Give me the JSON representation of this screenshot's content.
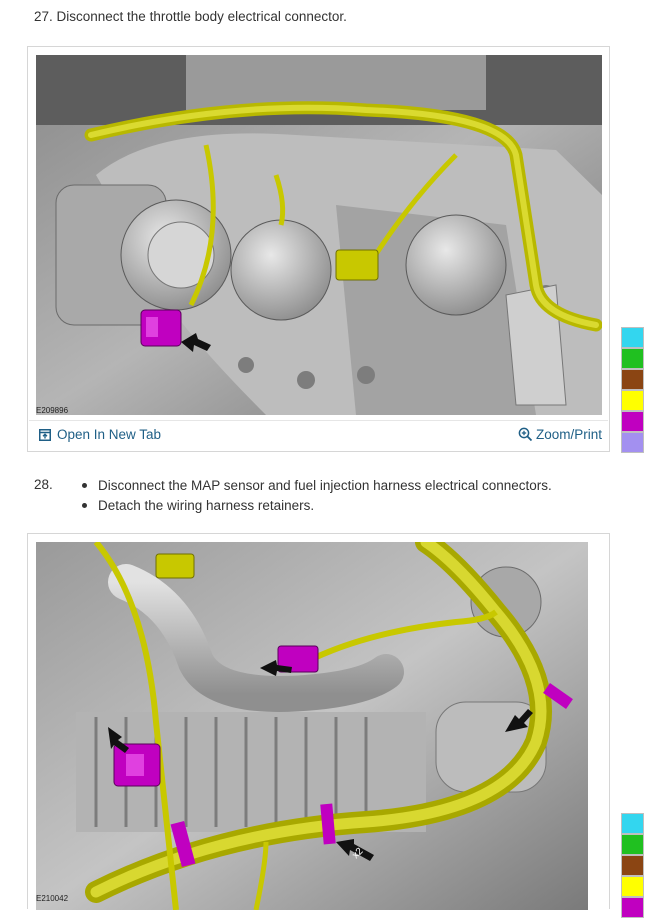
{
  "step27": {
    "title": "27. Disconnect the throttle body electrical connector.",
    "figure_code": "E209896",
    "open_in_new_tab": "Open In New Tab",
    "zoom_print": "Zoom/Print"
  },
  "step28": {
    "number": "28.",
    "bullets": [
      "Disconnect the MAP sensor and fuel injection harness electrical connectors.",
      "Detach the wiring harness retainers."
    ],
    "figure_code": "E210042",
    "callout_label": "x2"
  },
  "icons": {
    "open_tab": "open-in-new-tab-icon",
    "zoom": "zoom-in-icon"
  },
  "colors": {
    "link": "#1f5f86",
    "harness_yellow": "#c8c800",
    "connector_magenta": "#c000c0",
    "swatches_top": [
      "#33d6ef",
      "#20c020",
      "#8b4513",
      "#ffff00",
      "#c000c0",
      "#a390f0"
    ],
    "swatches_bottom": [
      "#33d6ef",
      "#20c020",
      "#8b4513",
      "#ffff00",
      "#c000c0"
    ]
  }
}
